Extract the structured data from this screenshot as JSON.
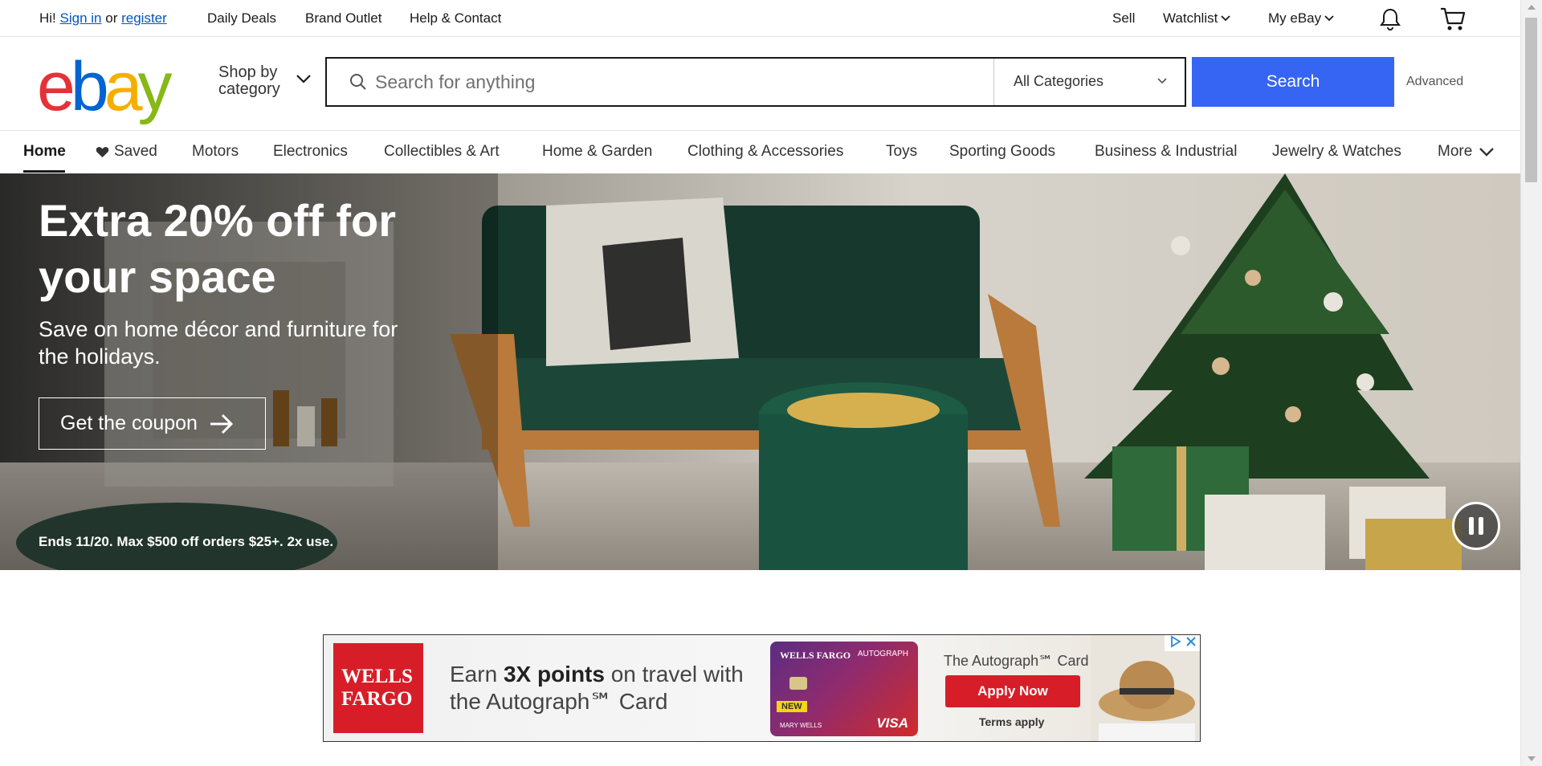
{
  "topbar": {
    "greeting": "Hi!",
    "sign_in": "Sign in",
    "or": "or",
    "register": "register",
    "daily_deals": "Daily Deals",
    "brand_outlet": "Brand Outlet",
    "help_contact": "Help & Contact",
    "sell": "Sell",
    "watchlist": "Watchlist",
    "my_ebay": "My eBay",
    "icons": [
      "bell-icon",
      "cart-icon"
    ]
  },
  "header": {
    "logo_letters": [
      "e",
      "b",
      "a",
      "y"
    ],
    "logo_colors": [
      "#e53238",
      "#0064d2",
      "#f5af02",
      "#86b817"
    ],
    "shop_by_line1": "Shop by",
    "shop_by_line2": "category",
    "search_placeholder": "Search for anything",
    "category_selected": "All Categories",
    "search_button": "Search",
    "advanced": "Advanced",
    "accent_color": "#3665f3"
  },
  "nav": {
    "items": [
      "Home",
      "Saved",
      "Motors",
      "Electronics",
      "Collectibles & Art",
      "Home & Garden",
      "Clothing & Accessories",
      "Toys",
      "Sporting Goods",
      "Business & Industrial",
      "Jewelry & Watches",
      "More"
    ]
  },
  "hero": {
    "headline": "Extra 20% off for your space",
    "subhead": "Save on home décor and furniture for the holidays.",
    "cta": "Get the coupon",
    "fine_print": "Ends 11/20. Max $500 off orders $25+. 2x use."
  },
  "ad": {
    "brand_line1": "WELLS",
    "brand_line2": "FARGO",
    "earn_pre": "Earn ",
    "earn_bold": "3X points",
    "earn_post": " on travel with",
    "earn_line2": "the Autograph℠ Card",
    "card_brand": "WELLS FARGO",
    "card_product": "AUTOGRAPH",
    "card_new": "NEW",
    "card_name": "MARY WELLS",
    "card_network": "VISA",
    "card_title": "The Autograph℠ Card",
    "apply": "Apply Now",
    "terms": "Terms apply"
  }
}
